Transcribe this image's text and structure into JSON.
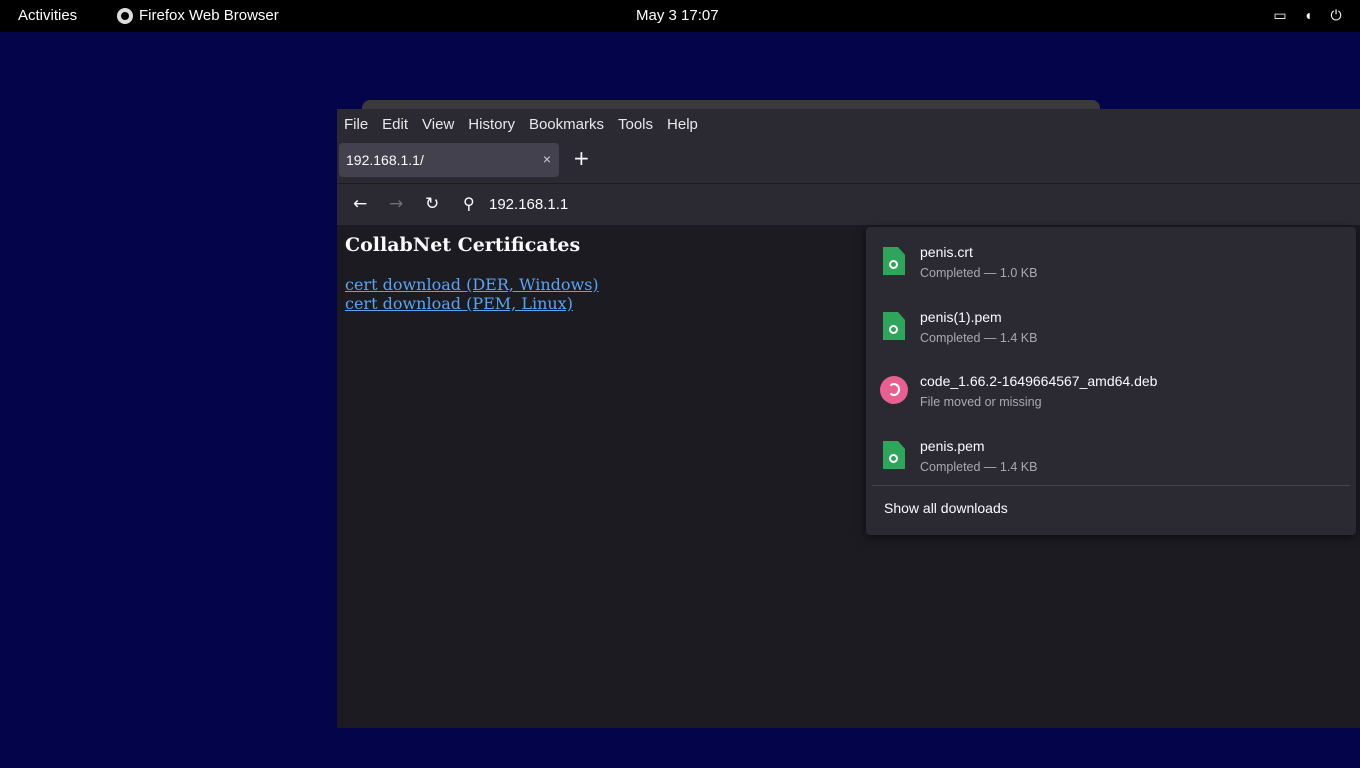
{
  "topbar": {
    "activities": "Activities",
    "app_name": "Firefox Web Browser",
    "clock": "May 3  17:07",
    "tray_icons": [
      "screen-icon",
      "volume-icon",
      "power-icon"
    ]
  },
  "menubar": {
    "items": [
      "File",
      "Edit",
      "View",
      "History",
      "Bookmarks",
      "Tools",
      "Help"
    ]
  },
  "tab": {
    "title": "192.168.1.1/",
    "close": "×",
    "new_tab": "+"
  },
  "navbar": {
    "back": "←",
    "forward": "→",
    "reload": "↻",
    "search_icon": "⚲",
    "url": "192.168.1.1"
  },
  "page": {
    "title": "CollabNet Certificates",
    "links": [
      "cert download (DER, Windows)",
      "cert download (PEM, Linux)"
    ]
  },
  "downloads": {
    "items": [
      {
        "name": "penis.crt",
        "status": "Completed — 1.0 KB",
        "icon": "certificate-file-icon"
      },
      {
        "name": "penis(1).pem",
        "status": "Completed — 1.4 KB",
        "icon": "certificate-file-icon"
      },
      {
        "name": "code_1.66.2-1649664567_amd64.deb",
        "status": "File moved or missing",
        "icon": "debian-package-icon"
      },
      {
        "name": "penis.pem",
        "status": "Completed — 1.4 KB",
        "icon": "certificate-file-icon"
      }
    ],
    "show_all": "Show all downloads"
  },
  "colors": {
    "desktop": "#03044a",
    "toolbar": "#2b2a33",
    "content": "#1c1b22",
    "link": "#5aa3f0",
    "file_green": "#2ea55a",
    "debian_pink": "#e8608f"
  }
}
